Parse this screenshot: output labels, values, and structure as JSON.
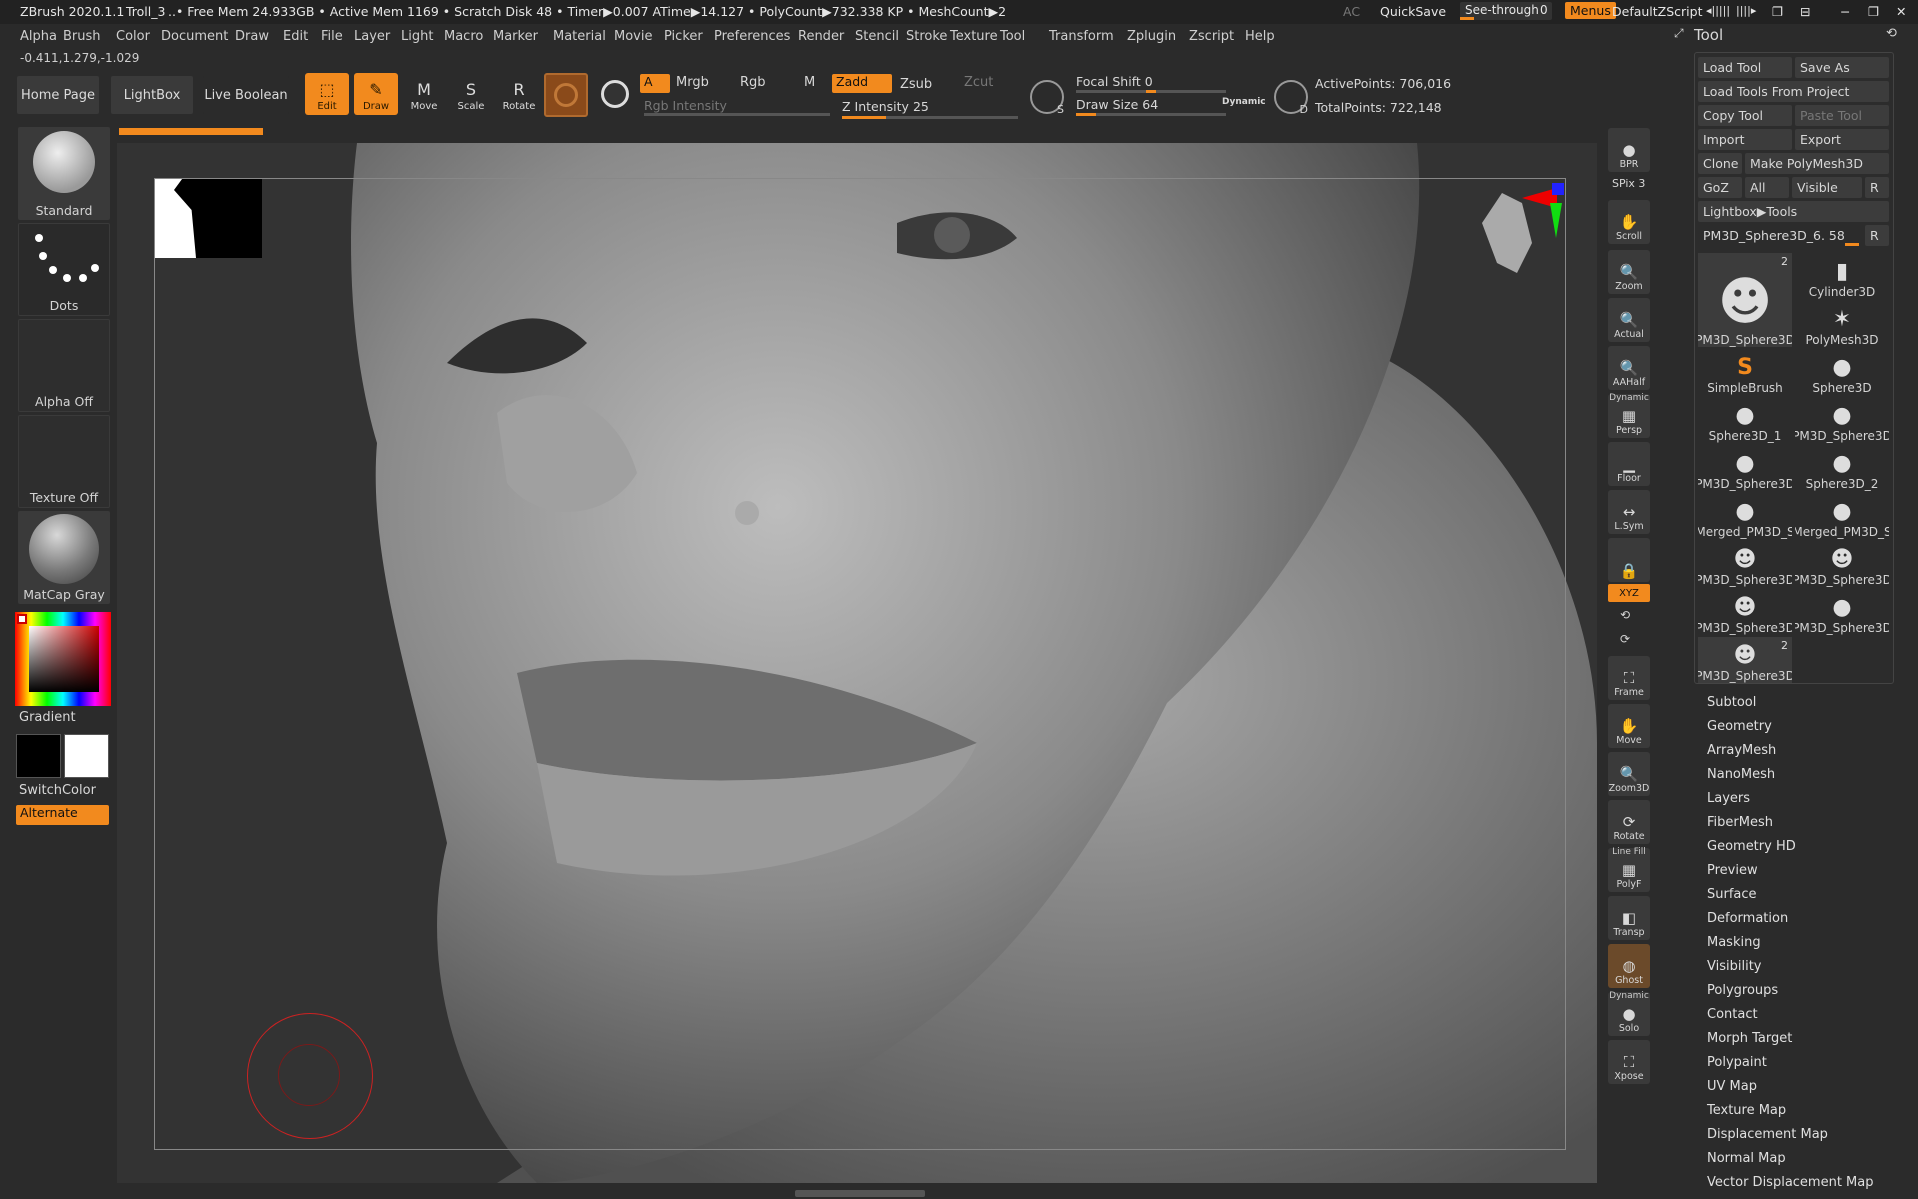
{
  "titlebar": {
    "app": "ZBrush 2020.1.1",
    "doc": "Troll_3",
    "stats": "..• Free Mem 24.933GB • Active Mem 1169 • Scratch Disk 48 • Timer▶0.007 ATime▶14.127 • PolyCount▶732.338 KP • MeshCount▶2",
    "ac": "AC",
    "quicksave": "QuickSave",
    "seethrough": "See-through",
    "seethrough_value": "0",
    "menus": "Menus",
    "script": "DefaultZScript",
    "icons": [
      "◂|||||",
      "||||▸",
      "❐",
      "⊟",
      "−",
      "❐",
      "✕"
    ]
  },
  "menubar": [
    "Alpha",
    "Brush",
    "Color",
    "Document",
    "Draw",
    "Edit",
    "File",
    "Layer",
    "Light",
    "Macro",
    "Marker",
    "Material",
    "Movie",
    "Picker",
    "Preferences",
    "Render",
    "Stencil",
    "Stroke",
    "Texture",
    "Tool",
    "Transform",
    "Zplugin",
    "Zscript",
    "Help"
  ],
  "coords": "-0.411,1.279,-1.029",
  "topbar": {
    "home": "Home Page",
    "lightbox": "LightBox",
    "liveboolean": "Live Boolean",
    "tools": [
      {
        "label": "Edit",
        "icon": "⬚",
        "active": true
      },
      {
        "label": "Draw",
        "icon": "✎",
        "active": true
      },
      {
        "label": "Move",
        "icon": "M",
        "active": false
      },
      {
        "label": "Scale",
        "icon": "S",
        "active": false
      },
      {
        "label": "Rotate",
        "icon": "R",
        "active": false
      }
    ],
    "a": "A",
    "mrgb": "Mrgb",
    "rgb": "Rgb",
    "m": "M",
    "zadd": "Zadd",
    "zsub": "Zsub",
    "zcut": "Zcut",
    "rgb_intensity": "Rgb Intensity",
    "z_intensity_label": "Z Intensity",
    "z_intensity": "25",
    "focal_label": "Focal Shift",
    "focal": "0",
    "drawsize_label": "Draw Size",
    "drawsize": "64",
    "dynamic": "Dynamic",
    "activepoints": "ActivePoints: 706,016",
    "totalpoints": "TotalPoints: 722,148",
    "s_label": "S",
    "d_label": "D",
    "z_intensity_fraction": 0.25,
    "drawsize_fraction": 0.13,
    "focal_fraction": 0.5
  },
  "leftpanel": {
    "brush": "Standard",
    "stroke": "Dots",
    "alpha": "Alpha Off",
    "texture": "Texture Off",
    "material": "MatCap Gray",
    "gradient": "Gradient",
    "switchcolor": "SwitchColor",
    "alternate": "Alternate"
  },
  "righttools": [
    {
      "label": "BPR",
      "icon": "●",
      "top": ""
    },
    {
      "label": "Scroll",
      "icon": "✋",
      "top": ""
    },
    {
      "label": "Zoom",
      "icon": "🔍",
      "top": ""
    },
    {
      "label": "Actual",
      "icon": "🔍",
      "top": ""
    },
    {
      "label": "AAHalf",
      "icon": "🔍",
      "top": ""
    },
    {
      "label": "Persp",
      "icon": "▦",
      "top": "Dynamic"
    },
    {
      "label": "Floor",
      "icon": "▁",
      "top": ""
    },
    {
      "label": "L.Sym",
      "icon": "↔",
      "top": ""
    },
    {
      "label": "",
      "icon": "🔒",
      "top": ""
    },
    {
      "label": "Frame",
      "icon": "⛶",
      "top": ""
    },
    {
      "label": "Move",
      "icon": "✋",
      "top": ""
    },
    {
      "label": "Zoom3D",
      "icon": "🔍",
      "top": ""
    },
    {
      "label": "Rotate",
      "icon": "⟳",
      "top": ""
    },
    {
      "label": "PolyF",
      "icon": "▦",
      "top": "Line Fill"
    },
    {
      "label": "Transp",
      "icon": "◧",
      "top": ""
    },
    {
      "label": "Ghost",
      "icon": "◍",
      "top": ""
    },
    {
      "label": "Solo",
      "icon": "●",
      "top": "Dynamic"
    },
    {
      "label": "Xpose",
      "icon": "⛶",
      "top": ""
    }
  ],
  "spix": "SPix 3",
  "xyz": "XYZ",
  "toolpanel": {
    "title": "Tool",
    "load": "Load Tool",
    "saveas": "Save As",
    "loadproj": "Load Tools From Project",
    "copy": "Copy Tool",
    "paste": "Paste Tool",
    "import": "Import",
    "export": "Export",
    "clone": "Clone",
    "makepoly": "Make PolyMesh3D",
    "goz": "GoZ",
    "all": "All",
    "visible": "Visible",
    "r": "R",
    "lightbox": "Lightbox▶Tools",
    "current": "PM3D_Sphere3D_6. 58",
    "items": [
      {
        "name": "PM3D_Sphere3D",
        "icon": "☻",
        "badge": "2"
      },
      {
        "name": "Cylinder3D",
        "icon": "▮",
        "badge": ""
      },
      {
        "name": "PM3D_Sphere3D",
        "icon": "☻",
        "badge": ""
      },
      {
        "name": "PolyMesh3D",
        "icon": "✶",
        "badge": ""
      },
      {
        "name": "SimpleBrush",
        "icon": "S",
        "badge": ""
      },
      {
        "name": "Sphere3D",
        "icon": "●",
        "badge": ""
      },
      {
        "name": "Sphere3D_1",
        "icon": "●",
        "badge": ""
      },
      {
        "name": "PM3D_Sphere3D",
        "icon": "●",
        "badge": ""
      },
      {
        "name": "PM3D_Sphere3D",
        "icon": "●",
        "badge": ""
      },
      {
        "name": "Sphere3D_2",
        "icon": "●",
        "badge": ""
      },
      {
        "name": "Merged_PM3D_S",
        "icon": "●",
        "badge": ""
      },
      {
        "name": "Merged_PM3D_S",
        "icon": "●",
        "badge": ""
      },
      {
        "name": "PM3D_Sphere3D",
        "icon": "☻",
        "badge": ""
      },
      {
        "name": "PM3D_Sphere3D",
        "icon": "☻",
        "badge": ""
      },
      {
        "name": "PM3D_Sphere3D",
        "icon": "☻",
        "badge": ""
      },
      {
        "name": "PM3D_Sphere3D",
        "icon": "●",
        "badge": ""
      },
      {
        "name": "PM3D_Sphere3D",
        "icon": "☻",
        "badge": "2"
      }
    ],
    "subpalettes": [
      "Subtool",
      "Geometry",
      "ArrayMesh",
      "NanoMesh",
      "Layers",
      "FiberMesh",
      "Geometry HD",
      "Preview",
      "Surface",
      "Deformation",
      "Masking",
      "Visibility",
      "Polygroups",
      "Contact",
      "Morph Target",
      "Polypaint",
      "UV Map",
      "Texture Map",
      "Displacement Map",
      "Normal Map",
      "Vector Displacement Map"
    ]
  },
  "colors": {
    "accent": "#f28a1e",
    "bg": "#2b2b2b"
  }
}
